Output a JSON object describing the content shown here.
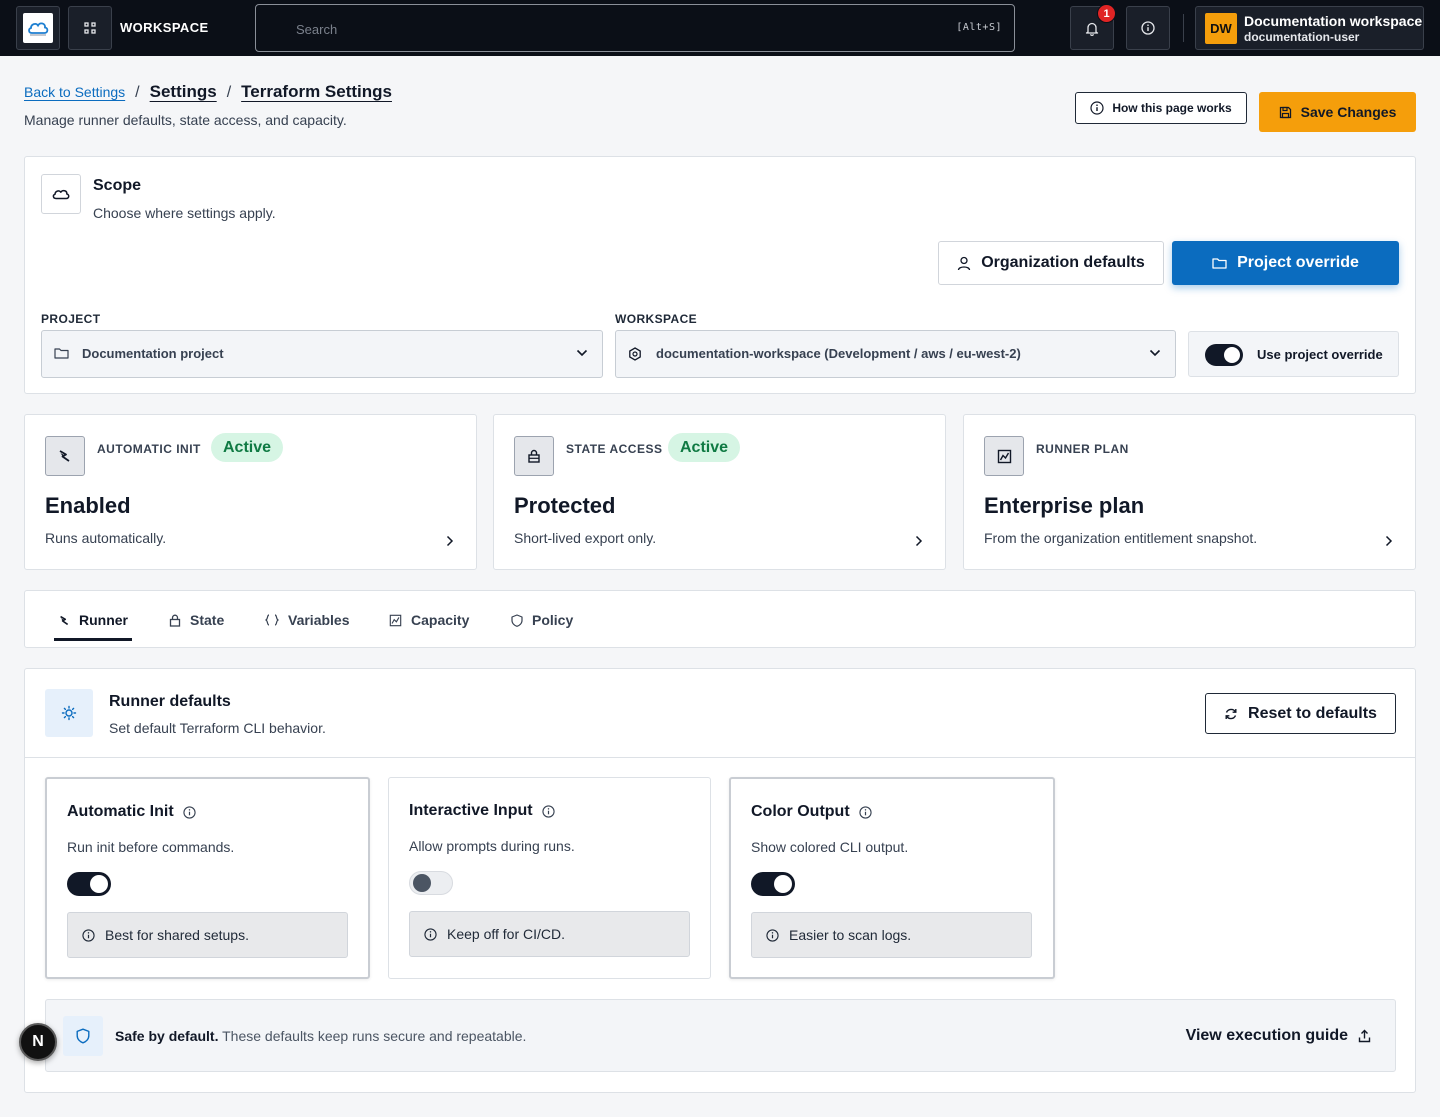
{
  "topbar": {
    "workspace_label": "WORKSPACE",
    "search_placeholder": "Search",
    "search_shortcut": "[Alt+S]",
    "notification_count": "1",
    "account_initials": "DW",
    "account_name": "Documentation workspace",
    "account_user": "documentation-user"
  },
  "header": {
    "back_link": "Back to Settings",
    "breadcrumb_1": "Settings",
    "breadcrumb_2": "Terraform Settings",
    "separator": "/",
    "subtitle": "Manage runner defaults, state access, and capacity.",
    "how_label": "How this page works",
    "save_label": "Save Changes"
  },
  "scope": {
    "title": "Scope",
    "subtitle": "Choose where settings apply.",
    "org_defaults_label": "Organization defaults",
    "project_override_label": "Project override",
    "project_field_label": "PROJECT",
    "project_value": "Documentation project",
    "workspace_field_label": "WORKSPACE",
    "workspace_value": "documentation-workspace (Development / aws / eu-west-2)",
    "use_override_label": "Use project override",
    "use_override_on": true
  },
  "stats": [
    {
      "label": "AUTOMATIC INIT",
      "pill": "Active",
      "value": "Enabled",
      "desc": "Runs automatically."
    },
    {
      "label": "STATE ACCESS",
      "pill": "Active",
      "value": "Protected",
      "desc": "Short-lived export only."
    },
    {
      "label": "RUNNER PLAN",
      "pill": "",
      "value": "Enterprise plan",
      "desc": "From the organization entitlement snapshot."
    }
  ],
  "tabs": [
    {
      "label": "Runner",
      "active": true
    },
    {
      "label": "State",
      "active": false
    },
    {
      "label": "Variables",
      "active": false
    },
    {
      "label": "Capacity",
      "active": false
    },
    {
      "label": "Policy",
      "active": false
    }
  ],
  "runner": {
    "title": "Runner defaults",
    "subtitle": "Set default Terraform CLI behavior.",
    "reset_label": "Reset to defaults",
    "options": [
      {
        "title": "Automatic Init",
        "desc": "Run init before commands.",
        "enabled": true,
        "note": "Best for shared setups."
      },
      {
        "title": "Interactive Input",
        "desc": "Allow prompts during runs.",
        "enabled": false,
        "note": "Keep off for CI/CD."
      },
      {
        "title": "Color Output",
        "desc": "Show colored CLI output.",
        "enabled": true,
        "note": "Easier to scan logs."
      }
    ],
    "safe_bold": "Safe by default.",
    "safe_text": "These defaults keep runs secure and repeatable.",
    "guide_label": "View execution guide"
  },
  "fab_label": "N",
  "colors": {
    "accent_blue": "#0b6cbf",
    "accent_orange": "#f59e0b",
    "active_green": "#0f7a43",
    "topbar_bg": "#0b0f17"
  }
}
